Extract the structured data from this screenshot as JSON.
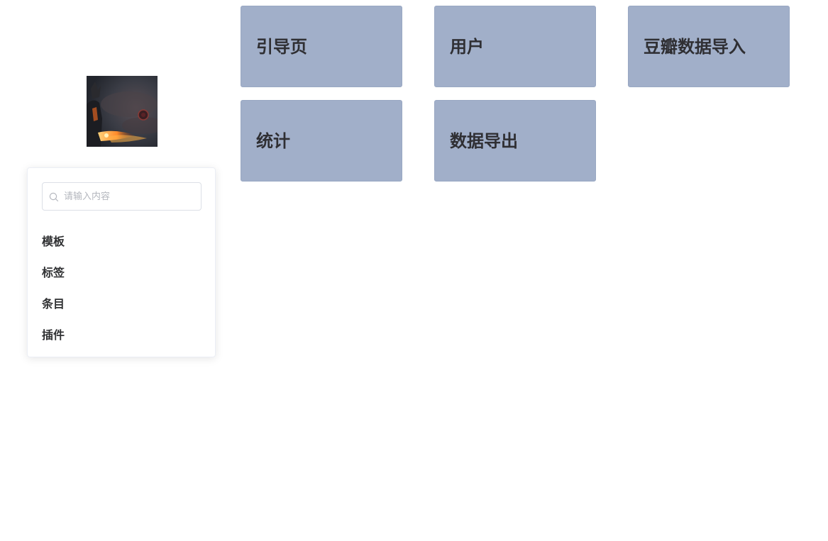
{
  "avatar": {
    "icon": "avatar-image"
  },
  "sidebar": {
    "search": {
      "placeholder": "请输入内容",
      "value": "",
      "icon": "search-icon"
    },
    "items": [
      {
        "label": "模板"
      },
      {
        "label": "标签"
      },
      {
        "label": "条目"
      },
      {
        "label": "插件"
      }
    ]
  },
  "cards": [
    {
      "label": "引导页"
    },
    {
      "label": "用户"
    },
    {
      "label": "豆瓣数据导入"
    },
    {
      "label": "统计"
    },
    {
      "label": "数据导出"
    }
  ],
  "colors": {
    "card_background": "#a1afc9",
    "card_text": "#2f2f33",
    "menu_text": "#303133"
  }
}
